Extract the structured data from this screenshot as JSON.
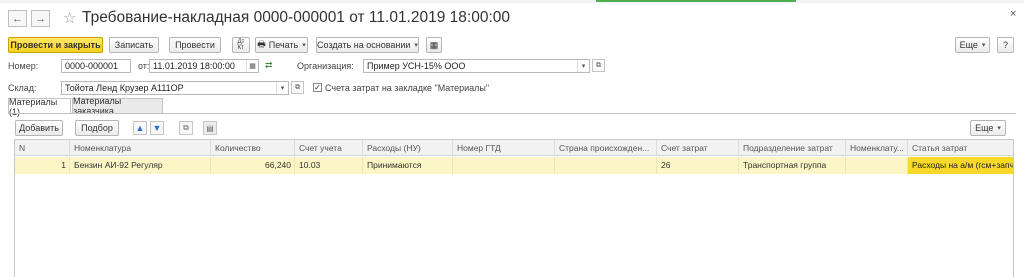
{
  "window": {
    "title": "Требование-накладная 0000-000001 от 11.01.2019 18:00:00",
    "back_icon": "←",
    "forward_icon": "→",
    "star_icon": "☆",
    "close_icon": "×"
  },
  "toolbar": {
    "post_and_close": "Провести и закрыть",
    "save": "Записать",
    "post": "Провести",
    "print": "Печать",
    "create_based_on": "Создать на основании",
    "more": "Еще",
    "help": "?"
  },
  "fields": {
    "number_label": "Номер:",
    "number_value": "0000-000001",
    "date_label": "от:",
    "date_value": "11.01.2019 18:00:00",
    "org_label": "Организация:",
    "org_value": "Пример УСН-15% ООО",
    "warehouse_label": "Склад:",
    "warehouse_value": "Тойота Ленд Крузер А111ОР",
    "cost_accounts_label": "Счета затрат на закладке \"Материалы\"",
    "cost_accounts_checked": true
  },
  "tabs": [
    {
      "label": "Материалы (1)",
      "active": true
    },
    {
      "label": "Материалы заказчика",
      "active": false
    }
  ],
  "table_toolbar": {
    "add": "Добавить",
    "pick": "Подбор",
    "more": "Еще"
  },
  "table": {
    "columns": [
      "N",
      "Номенклатура",
      "Количество",
      "Счет учета",
      "Расходы (НУ)",
      "Номер ГТД",
      "Страна происхожден...",
      "Счет затрат",
      "Подразделение затрат",
      "Номенклату...",
      "Статья затрат"
    ],
    "rows": [
      [
        "1",
        "Бензин АИ-92 Регуляр",
        "66,240",
        "10.03",
        "Принимаются",
        "",
        "",
        "26",
        "Транспортная группа",
        "",
        "Расходы на а/м (гсм+запч)"
      ]
    ]
  }
}
